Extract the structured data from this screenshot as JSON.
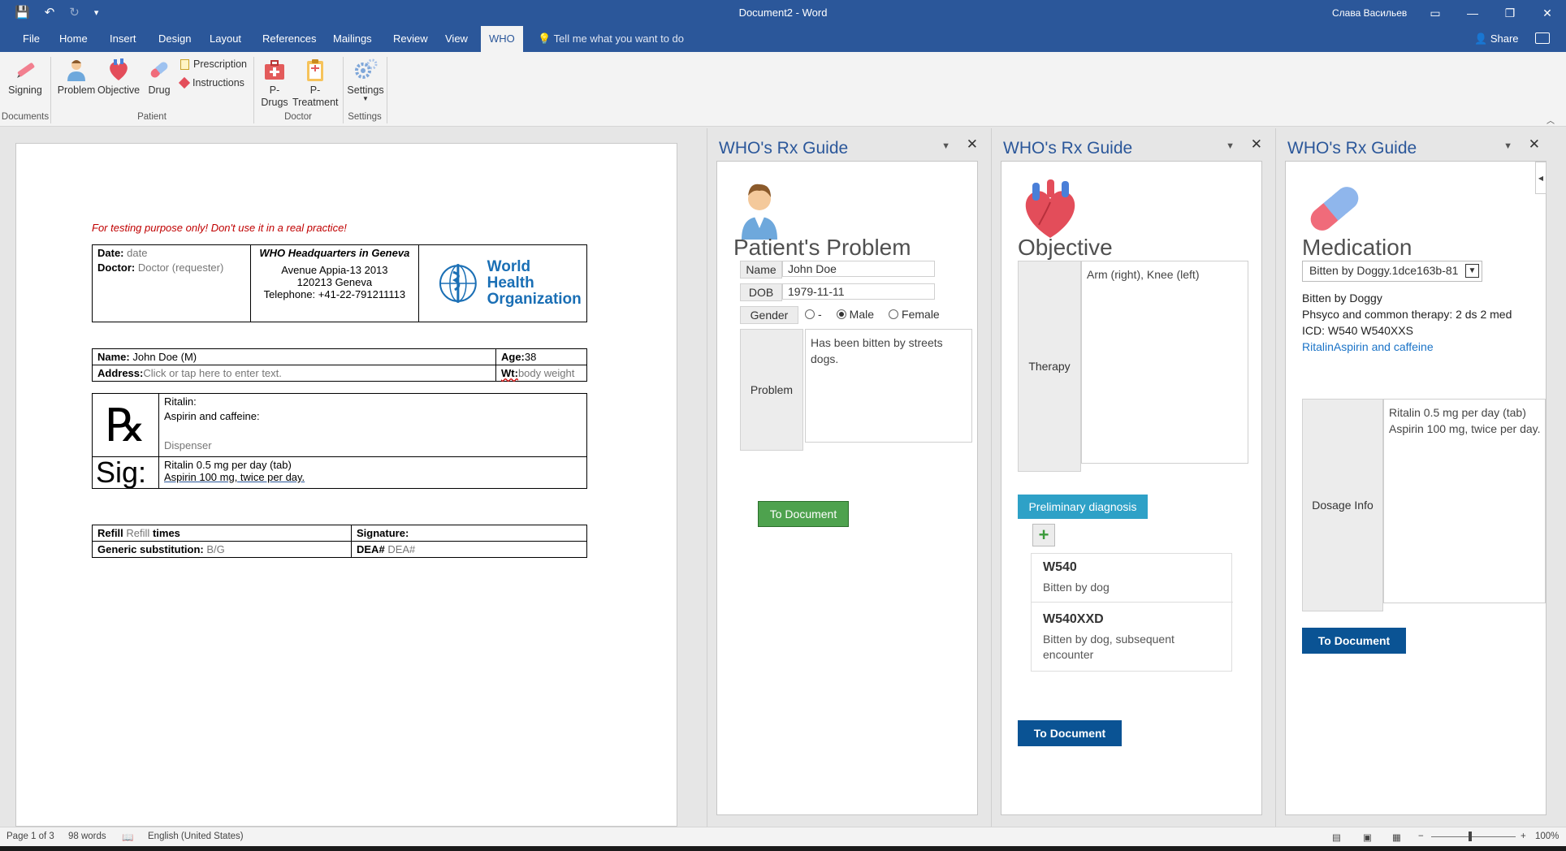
{
  "window": {
    "title": "Document2 - Word",
    "user": "Слава Васильев",
    "qat": {
      "save": "💾",
      "undo": "↶",
      "redo": "↻",
      "customize": "▾"
    },
    "buttons": {
      "ribbon_display": "▭",
      "minimize": "—",
      "restore": "❐",
      "close": "✕"
    }
  },
  "tabs": [
    "File",
    "Home",
    "Insert",
    "Design",
    "Layout",
    "References",
    "Mailings",
    "Review",
    "View",
    "WHO"
  ],
  "active_tab": "WHO",
  "tellme": "Tell me what you want to do",
  "share": "Share",
  "ribbon": {
    "signing": "Signing",
    "problem": "Problem",
    "objective": "Objective",
    "drug": "Drug",
    "prescription": "Prescription",
    "instructions": "Instructions",
    "pdrugs": "P-\nDrugs",
    "ptreatment": "P-\nTreatment",
    "settings": "Settings",
    "groups": {
      "documents": "Documents",
      "patient": "Patient",
      "doctor": "Doctor",
      "settings": "Settings"
    }
  },
  "document": {
    "warning": "For testing purpose only! Don't use it in a real practice!",
    "header": {
      "date_label": "Date:",
      "date_value": "date",
      "doctor_label": "Doctor:",
      "doctor_value": "Doctor (requester)",
      "hq": "WHO Headquarters in Geneva",
      "address1": "Avenue Appia-13 2013",
      "address2": "120213 Geneva",
      "telephone": "Telephone: +41-22-791211113",
      "logo_line1": "World Health",
      "logo_line2": "Organization"
    },
    "patient": {
      "name_label": "Name:",
      "name_value": "John Doe  (M)",
      "age_label": "Age:",
      "age_value": "38",
      "address_label": "Address:",
      "address_value": "Click or tap here to enter text.",
      "wt_label": "Wt:",
      "wt_value": "body weight"
    },
    "rx": {
      "symbol": "℞",
      "drug1": "Ritalin:",
      "drug2": "Aspirin and caffeine:",
      "dispenser": "Dispenser",
      "sig_label": "Sig:",
      "sig1": "Ritalin 0.5 mg per day (tab)",
      "sig2": "Aspirin  100 mg, twice per day."
    },
    "footer": {
      "refill_label": "Refill",
      "refill_value": "Refill",
      "refill_suffix": "times",
      "signature_label": "Signature:",
      "generic_label": "Generic substitution:",
      "generic_value": "B/G",
      "dea_label": "DEA#",
      "dea_value": "DEA#"
    }
  },
  "panes": [
    {
      "title": "WHO's Rx Guide",
      "heading": "Patient's Problem",
      "name_label": "Name",
      "name_value": "John Doe",
      "dob_label": "DOB",
      "dob_value": "1979-11-11",
      "gender_label": "Gender",
      "gender_options": [
        "-",
        "Male",
        "Female"
      ],
      "gender_selected": "Male",
      "problem_label": "Problem",
      "problem_value": "Has been bitten by streets dogs.",
      "button": "To Document"
    },
    {
      "title": "WHO's Rx Guide",
      "heading": "Objective",
      "therapy_label": "Therapy",
      "therapy_value": "Arm (right), Knee (left)",
      "diag_button": "Preliminary diagnosis",
      "add_icon": "+",
      "codes": [
        {
          "code": "W540",
          "desc": "Bitten by dog"
        },
        {
          "code": "W540XXD",
          "desc": "Bitten by dog, subsequent encounter"
        }
      ],
      "button": "To Document"
    },
    {
      "title": "WHO's Rx Guide",
      "heading": "Medication",
      "select_value": "Bitten by Doggy.1dce163b-81",
      "info1": "Bitten by Doggy",
      "info2": "Phsyco and common therapy: 2 ds 2 med",
      "info3": "ICD: W540 W540XXS",
      "link": "RitalinAspirin and caffeine",
      "dosage_label": "Dosage Info",
      "dosage1": "Ritalin 0.5 mg per day (tab)",
      "dosage2": "Aspirin  100 mg, twice per day.",
      "button": "To Document"
    }
  ],
  "status": {
    "page": "Page 1 of 3",
    "words": "98 words",
    "language": "English (United States)",
    "zoom": "100%",
    "zoom_minus": "−",
    "zoom_plus": "+"
  }
}
